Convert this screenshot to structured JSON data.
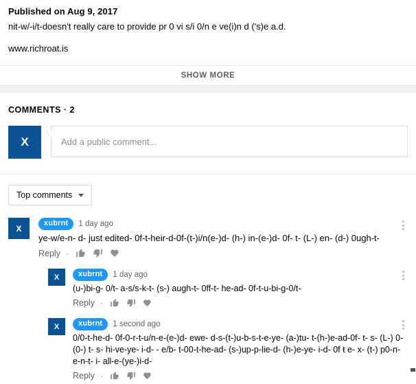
{
  "description": {
    "published": "Published on Aug 9, 2017",
    "body": "nit-w/-i/t-doesn't really care to provide pr 0 vi s/i 0/n e ve(i)n d ('s)e a.d.",
    "link": "www.richroat.is",
    "show_more_label": "SHOW MORE"
  },
  "comments_section": {
    "header": "COMMENTS · 2",
    "add_comment": {
      "avatar_initial": "X",
      "placeholder": "Add a public comment..."
    },
    "sort": {
      "label": "Top comments",
      "caret_icon": "chevron-down-icon"
    },
    "actions": {
      "reply_label": "Reply",
      "separator": "·",
      "like_icon": "thumbs-up-icon",
      "dislike_icon": "thumbs-down-icon",
      "heart_icon": "heart-icon",
      "menu_icon": "kebab-menu-icon"
    },
    "threads": [
      {
        "avatar_initial": "X",
        "username": "xubrnt",
        "timestamp": "1 day ago",
        "text": "ye-w/e-n- d- just edited- 0f-t-heir-d-0f-(t-)i/n(e-)d- (h-) in-(e-)d- 0f- t- (L-) en- (d-) 0ugh-t-",
        "replies": [
          {
            "avatar_initial": "X",
            "username": "xubrnt",
            "timestamp": "1 day ago",
            "text": "(u-)bi-g- 0/t- a-s/s-k-t- (s-) augh-t- 0ff-t- he-ad- 0f-t-u-bi-g-0/t-"
          },
          {
            "avatar_initial": "X",
            "username": "xubrnt",
            "timestamp": "1 second ago",
            "text": "0/0-t-he-d- 0f-0-r-t-u/n-e-(e-)d- ewe- d-s-(t-)u-b-s-t-e-ye- (a-)tu- t-(h-)e-ad-0f- t- s- (L-) 0-(0-) t- s- hi-ve-ye- i-d- - e/b- t-00-t-he-ad- (s-)up-p-lie-d- (h-)e-ye- i-d- 0f ŧ e- x- (t-) p0-n-e-n-t- i- all-e-(ye-)i-d-"
          }
        ]
      }
    ]
  },
  "colors": {
    "avatar_bg": "#0b5394",
    "username_badge": "#2196f3",
    "band_bg": "#f1f1f1",
    "muted_text": "#606060"
  }
}
